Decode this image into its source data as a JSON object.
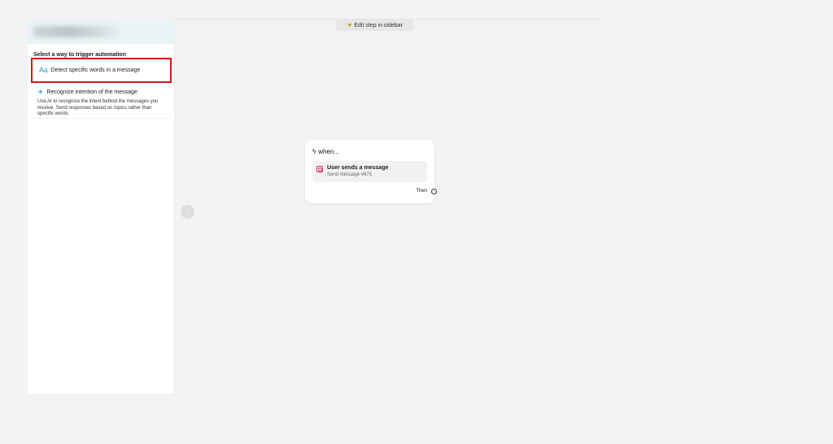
{
  "toolbar": {
    "edit_hint_icon": "pointing-hand-icon",
    "edit_hint_label": "Edit step in sidebar"
  },
  "sidebar": {
    "section_title": "Select a way to trigger automation",
    "options": [
      {
        "icon": "text-aa-icon",
        "icon_glyph": "Aa",
        "label": "Detect specific words in a message",
        "highlighted": true
      },
      {
        "icon": "sparkle-icon",
        "icon_glyph": "✦",
        "label": "Recognize intention of the message",
        "description": "Use AI to recognize the intent behind the messages you receive. Send responses based on topics rather than specific words."
      }
    ]
  },
  "node": {
    "header_icon": "bolt-icon",
    "header_label": "when...",
    "trigger": {
      "icon": "instagram-icon",
      "title": "User sends a message",
      "subtitle": "Send message #675"
    },
    "then_label": "Then"
  },
  "colors": {
    "highlight_border": "#e0121b",
    "accent_teal": "#2e9bb8",
    "instagram": "#d6306c",
    "sidebar_header_bg": "#e8f4f5"
  }
}
